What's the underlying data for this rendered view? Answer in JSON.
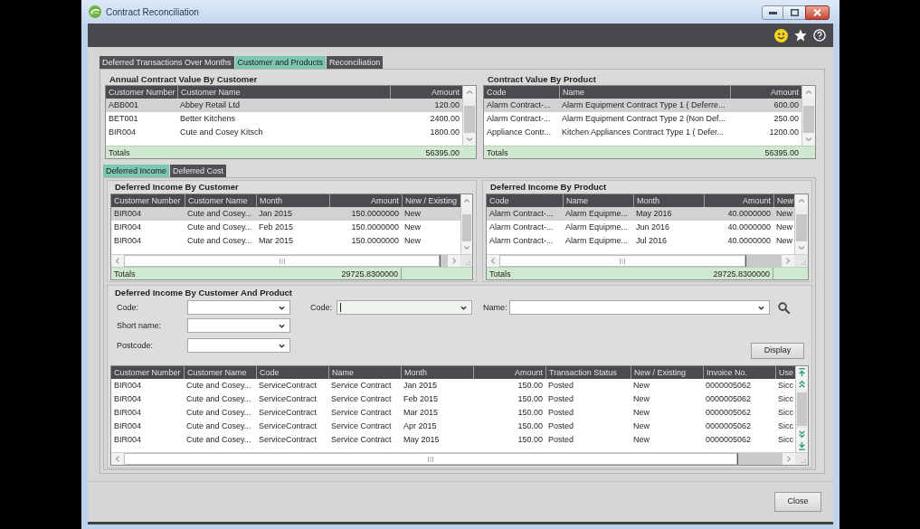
{
  "window": {
    "title": "Contract Reconciliation"
  },
  "tabs": [
    {
      "label": "Deferred Transactions Over Months",
      "selected": false
    },
    {
      "label": "Customer and Products",
      "selected": true
    },
    {
      "label": "Reconciliation",
      "selected": false
    }
  ],
  "annual_contract_value_by_customer": {
    "title": "Annual Contract Value By Customer",
    "columns": [
      "Customer Number",
      "Customer Name",
      "Amount"
    ],
    "rows": [
      {
        "cells": [
          "ABB001",
          "Abbey Retail Ltd",
          "120.00"
        ],
        "selected": true
      },
      {
        "cells": [
          "BET001",
          "Better Kitchens",
          "2400.00"
        ],
        "selected": false
      },
      {
        "cells": [
          "BIR004",
          "Cute and Cosey Kitsch",
          "1800.00"
        ],
        "selected": false
      }
    ],
    "totals": {
      "label": "Totals",
      "value": "56395.00"
    }
  },
  "contract_value_by_product": {
    "title": "Contract Value By Product",
    "columns": [
      "Code",
      "Name",
      "Amount"
    ],
    "rows": [
      {
        "cells": [
          "Alarm Contract-...",
          "Alarm Equipment Contract Type 1 ( Deferre...",
          "600.00"
        ],
        "selected": true
      },
      {
        "cells": [
          "Alarm Contract-...",
          "Alarm Equipment Contract Type 2 (Non Def...",
          "250.00"
        ],
        "selected": false
      },
      {
        "cells": [
          "Appliance Contr...",
          "Kitchen Appliances Contract Type 1 ( Defer...",
          "1200.00"
        ],
        "selected": false
      }
    ],
    "totals": {
      "label": "Totals",
      "value": "56395.00"
    }
  },
  "sub_tabs": [
    {
      "label": "Deferred Income",
      "selected": true
    },
    {
      "label": "Deferred Cost",
      "selected": false
    }
  ],
  "deferred_income_by_customer": {
    "title": "Deferred Income By Customer",
    "columns": [
      "Customer Number",
      "Customer Name",
      "Month",
      "Amount",
      "New / Existing"
    ],
    "rows": [
      {
        "cells": [
          "BIR004",
          "Cute and Cosey...",
          "Jan 2015",
          "150.0000000",
          "New"
        ],
        "selected": true
      },
      {
        "cells": [
          "BIR004",
          "Cute and Cosey...",
          "Feb 2015",
          "150.0000000",
          "New"
        ],
        "selected": false
      },
      {
        "cells": [
          "BIR004",
          "Cute and Cosey...",
          "Mar 2015",
          "150.0000000",
          "New"
        ],
        "selected": false
      }
    ],
    "totals": {
      "label": "Totals",
      "value": "29725.8300000"
    }
  },
  "deferred_income_by_product": {
    "title": "Deferred Income By Product",
    "columns": [
      "Code",
      "Name",
      "Month",
      "Amount",
      "New"
    ],
    "rows": [
      {
        "cells": [
          "Alarm Contract-...",
          "Alarm Equipme...",
          "May 2016",
          "40.0000000",
          "New"
        ],
        "selected": true
      },
      {
        "cells": [
          "Alarm Contract-...",
          "Alarm Equipme...",
          "Jun 2016",
          "40.0000000",
          "New"
        ],
        "selected": false
      },
      {
        "cells": [
          "Alarm Contract-...",
          "Alarm Equipme...",
          "Jul 2016",
          "40.0000000",
          "New"
        ],
        "selected": false
      }
    ],
    "totals": {
      "label": "Totals",
      "value": "29725.8300000"
    }
  },
  "deferred_income_by_customer_and_product": {
    "title": "Deferred Income By Customer And Product",
    "filters": [
      {
        "label": "Code:",
        "focused": false
      },
      {
        "label": "Short name:",
        "focused": false
      },
      {
        "label": "Postcode:",
        "focused": false
      },
      {
        "label": "Code:",
        "focused": true
      },
      {
        "label": "Name:",
        "focused": false
      }
    ],
    "display_button": "Display",
    "grid": {
      "columns": [
        "Customer Number",
        "Customer Name",
        "Code",
        "Name",
        "Month",
        "Amount",
        "Transaction Status",
        "New / Existing",
        "Invoice No.",
        "Use"
      ],
      "rows": [
        {
          "cells": [
            "BIR004",
            "Cute and Cosey...",
            "ServiceContract",
            "Service Contract",
            "Jan 2015",
            "150.00",
            "Posted",
            "New",
            "0000005062",
            "Sicc"
          ],
          "selected": false
        },
        {
          "cells": [
            "BIR004",
            "Cute and Cosey...",
            "ServiceContract",
            "Service Contract",
            "Feb 2015",
            "150.00",
            "Posted",
            "New",
            "0000005062",
            "Sicc"
          ],
          "selected": false
        },
        {
          "cells": [
            "BIR004",
            "Cute and Cosey...",
            "ServiceContract",
            "Service Contract",
            "Mar 2015",
            "150.00",
            "Posted",
            "New",
            "0000005062",
            "Sicc"
          ],
          "selected": false
        },
        {
          "cells": [
            "BIR004",
            "Cute and Cosey...",
            "ServiceContract",
            "Service Contract",
            "Apr 2015",
            "150.00",
            "Posted",
            "New",
            "0000005062",
            "Sicc"
          ],
          "selected": false
        },
        {
          "cells": [
            "BIR004",
            "Cute and Cosey...",
            "ServiceContract",
            "Service Contract",
            "May 2015",
            "150.00",
            "Posted",
            "New",
            "0000005062",
            "Sicc"
          ],
          "selected": false
        }
      ]
    }
  },
  "close_button": "Close"
}
